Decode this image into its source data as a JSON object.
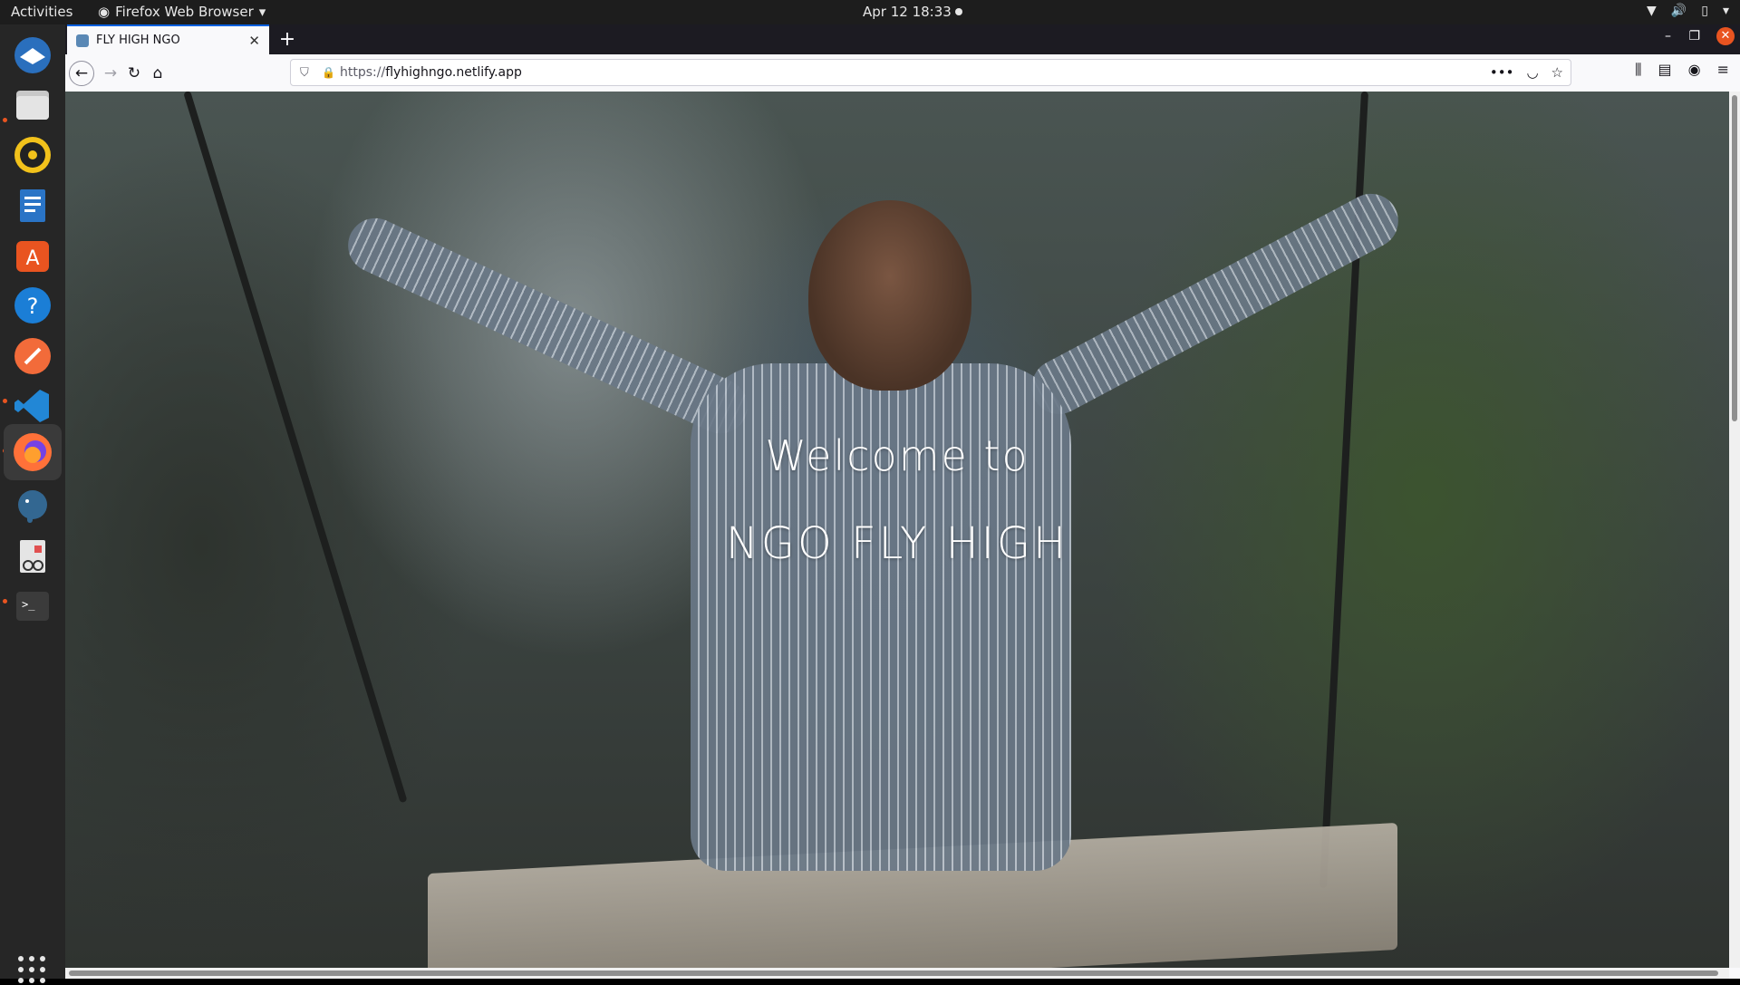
{
  "topbar": {
    "activities": "Activities",
    "app_name": "Firefox Web Browser",
    "clock": "Apr 12  18:33"
  },
  "dock": {
    "items": [
      {
        "name": "thunderbird",
        "color": "#2a6fbd"
      },
      {
        "name": "files",
        "color": "#c8c8c8"
      },
      {
        "name": "rhythmbox",
        "color": "#f2c21b"
      },
      {
        "name": "libreoffice-writer",
        "color": "#2a74c6"
      },
      {
        "name": "ubuntu-software",
        "color": "#e95420"
      },
      {
        "name": "help",
        "color": "#1b7ed6"
      },
      {
        "name": "postman",
        "color": "#f26b3a"
      },
      {
        "name": "vscode",
        "color": "#2287d6"
      },
      {
        "name": "firefox",
        "color": "#ff7139"
      },
      {
        "name": "pgadmin",
        "color": "#336791"
      },
      {
        "name": "document-viewer",
        "color": "#e5e5e5"
      },
      {
        "name": "terminal",
        "color": "#3b3b3b"
      }
    ]
  },
  "browser": {
    "tab_title": "FLY HIGH NGO",
    "url_scheme": "https://",
    "url_host": "flyhighngo.netlify.app"
  },
  "page": {
    "welcome": "Welcome to",
    "brand": "NGO FLY HIGH"
  }
}
